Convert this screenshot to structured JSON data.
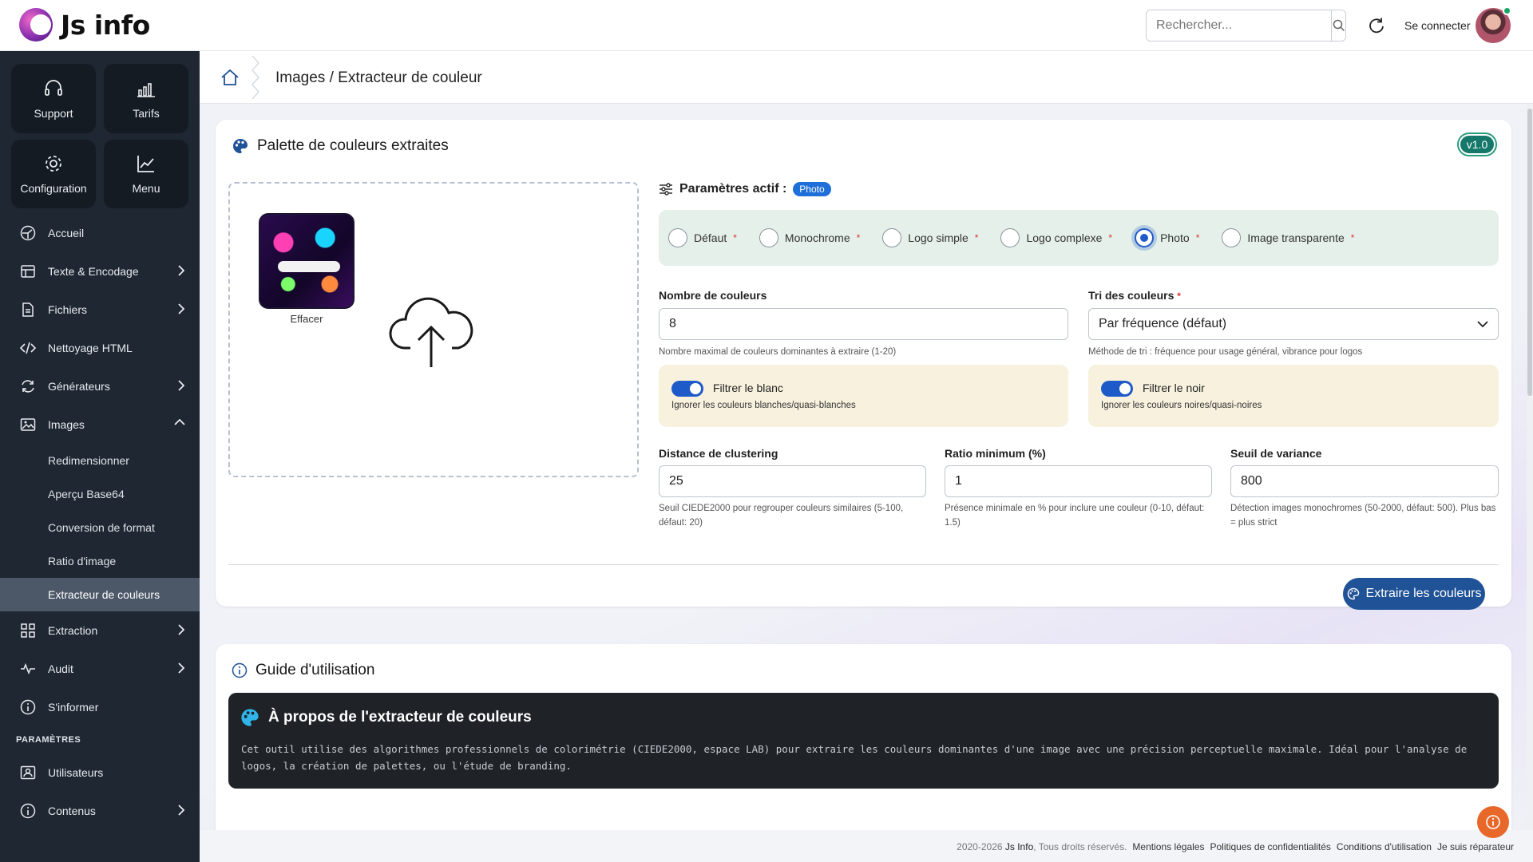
{
  "app": {
    "logo_text": "Js info"
  },
  "header": {
    "search_placeholder": "Rechercher...",
    "login_label": "Se connecter"
  },
  "sidebar": {
    "tiles": [
      {
        "label": "Support",
        "icon": "headset-icon"
      },
      {
        "label": "Tarifs",
        "icon": "bar-chart-icon"
      },
      {
        "label": "Configuration",
        "icon": "gear-icon"
      },
      {
        "label": "Menu",
        "icon": "trend-icon"
      }
    ],
    "items": [
      {
        "label": "Accueil",
        "icon": "dashboard-icon"
      },
      {
        "label": "Texte & Encodage",
        "icon": "text-encoding-icon"
      },
      {
        "label": "Fichiers",
        "icon": "file-icon"
      },
      {
        "label": "Nettoyage HTML",
        "icon": "code-icon"
      },
      {
        "label": "Générateurs",
        "icon": "refresh-icon"
      },
      {
        "label": "Images",
        "icon": "image-icon"
      }
    ],
    "image_subitems": [
      "Redimensionner",
      "Aperçu Base64",
      "Conversion de format",
      "Ratio d'image",
      "Extracteur de couleurs"
    ],
    "items_after": [
      {
        "label": "Extraction",
        "icon": "grid-icon"
      },
      {
        "label": "Audit",
        "icon": "pulse-icon"
      },
      {
        "label": "S'informer",
        "icon": "info-icon"
      }
    ],
    "section_label": "PARAMÈTRES",
    "settings_items": [
      {
        "label": "Utilisateurs",
        "icon": "user-card-icon"
      },
      {
        "label": "Contenus",
        "icon": "info-icon"
      }
    ]
  },
  "breadcrumb": {
    "text": "Images / Extracteur de couleur"
  },
  "palette_card": {
    "title": "Palette de couleurs extraites",
    "version": "v1.0",
    "thumb_label": "Effacer",
    "params_title": "Paramètres actif :",
    "active_badge": "Photo",
    "presets": [
      {
        "label": "Défaut",
        "selected": false
      },
      {
        "label": "Monochrome",
        "selected": false
      },
      {
        "label": "Logo simple",
        "selected": false
      },
      {
        "label": "Logo complexe",
        "selected": false
      },
      {
        "label": "Photo",
        "selected": true
      },
      {
        "label": "Image transparente",
        "selected": false
      }
    ],
    "required_mark": "*",
    "color_count": {
      "label": "Nombre de couleurs",
      "value": "8",
      "help": "Nombre maximal de couleurs dominantes à extraire (1-20)"
    },
    "sort": {
      "label": "Tri des couleurs",
      "value": "Par fréquence (défaut)",
      "help": "Méthode de tri : fréquence pour usage général, vibrance pour logos"
    },
    "filter_white": {
      "label": "Filtrer le blanc",
      "help": "Ignorer les couleurs blanches/quasi-blanches",
      "on": true
    },
    "filter_black": {
      "label": "Filtrer le noir",
      "help": "Ignorer les couleurs noires/quasi-noires",
      "on": true
    },
    "clustering": {
      "label": "Distance de clustering",
      "value": "25",
      "help": "Seuil CIEDE2000 pour regrouper couleurs similaires (5-100, défaut: 20)"
    },
    "min_ratio": {
      "label": "Ratio minimum (%)",
      "value": "1",
      "help": "Présence minimale en % pour inclure une couleur (0-10, défaut: 1.5)"
    },
    "variance": {
      "label": "Seuil de variance",
      "value": "800",
      "help": "Détection images monochromes (50-2000, défaut: 500). Plus bas = plus strict"
    },
    "extract_button": "Extraire les couleurs"
  },
  "guide_card": {
    "title": "Guide d'utilisation",
    "about_title": "À propos de l'extracteur de couleurs",
    "about_text": "Cet outil utilise des algorithmes professionnels de colorimétrie (CIEDE2000, espace LAB) pour extraire les couleurs dominantes d'une image avec une précision perceptuelle maximale. Idéal pour l'analyse de logos, la création de palettes, ou l'étude de branding."
  },
  "footer": {
    "copyright_years": "2020-2026",
    "brand": "Js Info",
    "rights": ", Tous droits réservés.",
    "links": [
      "Mentions légales",
      "Politiques de confidentialités",
      "Conditions d'utilisation",
      "Je suis réparateur"
    ]
  },
  "colors": {
    "sidebar_bg": "#1e2732",
    "accent_blue": "#1f5296",
    "version_badge": "#15786a",
    "presets_bg": "#e5f0ea",
    "toggle_box_bg": "#f7f1de",
    "help_fab": "#e8682a"
  }
}
